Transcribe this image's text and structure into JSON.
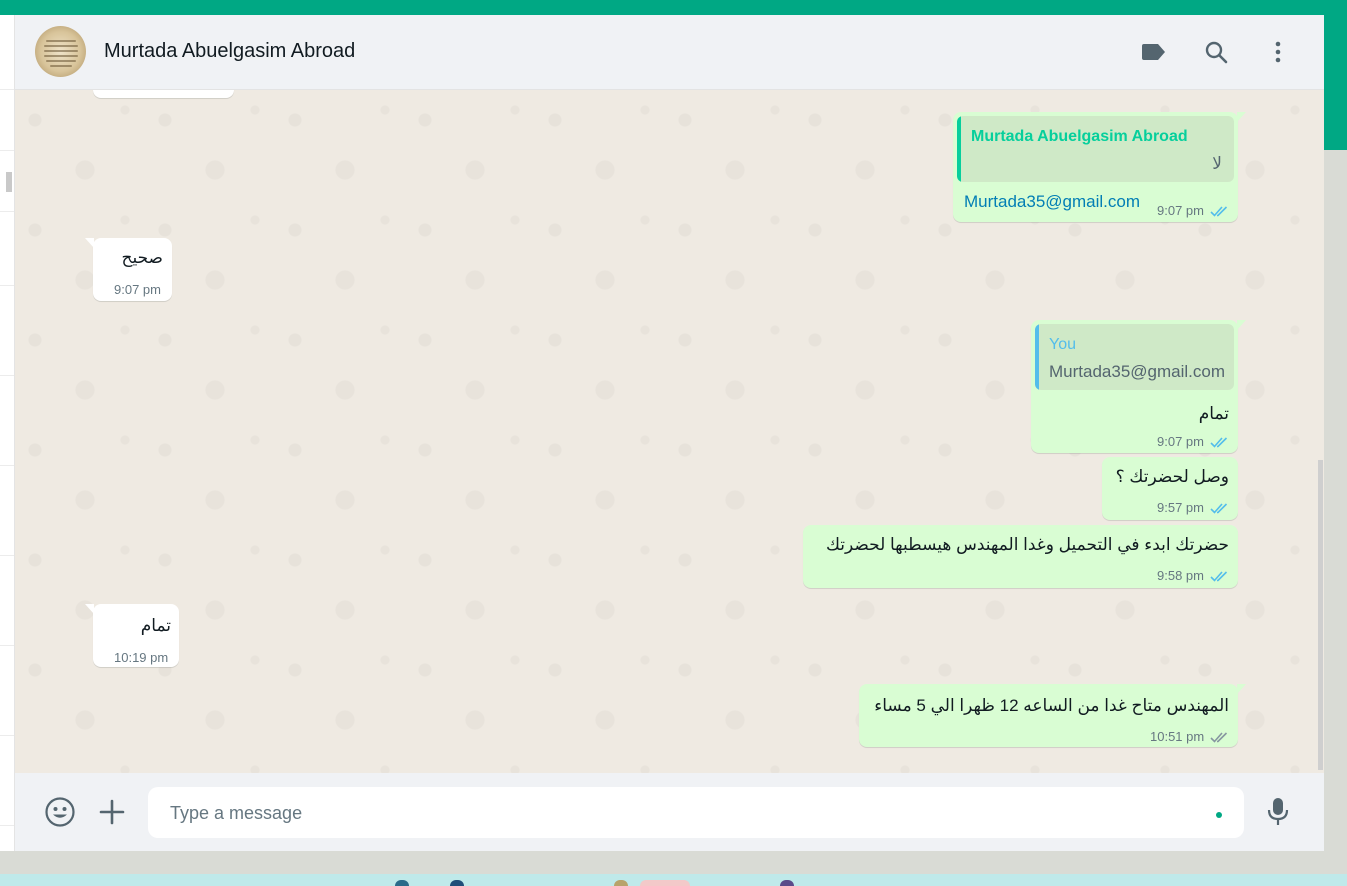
{
  "header": {
    "contact_name": "Murtada Abuelgasim Abroad"
  },
  "icons": {
    "label": "label-icon",
    "search": "search-icon",
    "menu": "more-vertical-icon",
    "emoji": "emoji-icon",
    "attach": "plus-icon",
    "mic": "microphone-icon",
    "read": "double-check-icon"
  },
  "colors": {
    "accent": "#00a884",
    "outgoing_bubble": "#d9fdd3",
    "incoming_bubble": "#ffffff",
    "chat_background": "#efeae2",
    "read_tick": "#53bdeb"
  },
  "messages": [
    {
      "direction": "out",
      "quote_author": "Murtada Abuelgasim Abroad",
      "quote_text": "لا",
      "text": "Murtada35@gmail.com",
      "time": "9:07 pm"
    },
    {
      "direction": "in",
      "text": "صحيح",
      "time": "9:07 pm"
    },
    {
      "direction": "out",
      "quote_author": "You",
      "quote_text": "Murtada35@gmail.com",
      "text": "تمام",
      "time": "9:07 pm"
    },
    {
      "direction": "out",
      "text": "وصل لحضرتك ؟",
      "time": "9:57 pm"
    },
    {
      "direction": "out",
      "text": "حضرتك ابدء في التحميل وغدا المهندس هيسطبها لحضرتك",
      "time": "9:58 pm"
    },
    {
      "direction": "in",
      "text": "تمام",
      "time": "10:19 pm"
    },
    {
      "direction": "out",
      "text": "المهندس متاح غدا من الساعه 12 ظهرا الي 5 مساء",
      "time": "10:51 pm"
    }
  ],
  "composer": {
    "placeholder": "Type a message",
    "value": ""
  }
}
